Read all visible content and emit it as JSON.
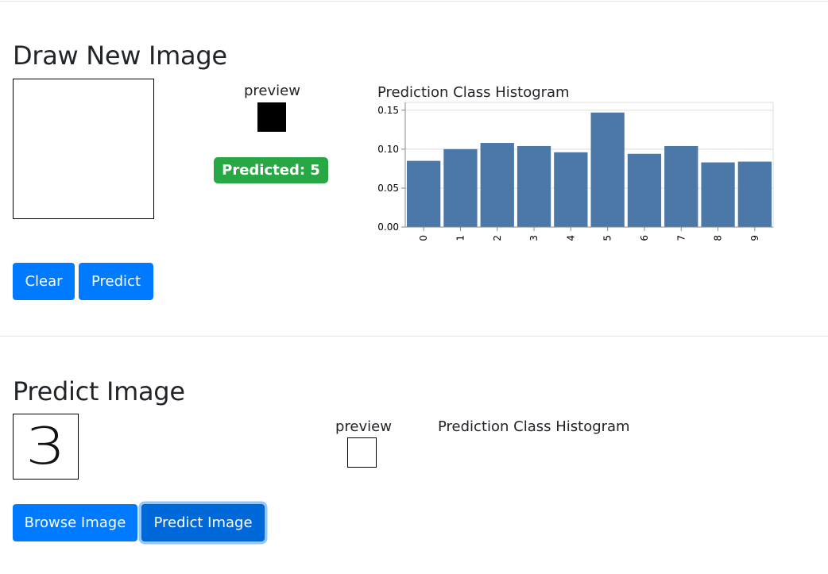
{
  "draw_section": {
    "title": "Draw New Image",
    "preview_label": "preview",
    "prediction_badge": "Predicted: 5",
    "clear_button": "Clear",
    "predict_button": "Predict"
  },
  "predict_section": {
    "title": "Predict Image",
    "image_digit": "3",
    "preview_label": "preview",
    "histogram_title": "Prediction Class Histogram",
    "browse_button": "Browse Image",
    "predict_button": "Predict Image"
  },
  "colors": {
    "primary": "#007bff",
    "success": "#28a745",
    "bar": "#4c78a8"
  },
  "chart_data": {
    "type": "bar",
    "title": "Prediction Class Histogram",
    "categories": [
      "0",
      "1",
      "2",
      "3",
      "4",
      "5",
      "6",
      "7",
      "8",
      "9"
    ],
    "values": [
      0.085,
      0.1,
      0.108,
      0.104,
      0.096,
      0.147,
      0.094,
      0.104,
      0.083,
      0.084
    ],
    "ylim": [
      0,
      0.16
    ],
    "yticks": [
      "0.00",
      "0.05",
      "0.10",
      "0.15"
    ],
    "ytick_values": [
      0,
      0.05,
      0.1,
      0.15
    ],
    "grid": true,
    "xlabel": "",
    "ylabel": ""
  }
}
